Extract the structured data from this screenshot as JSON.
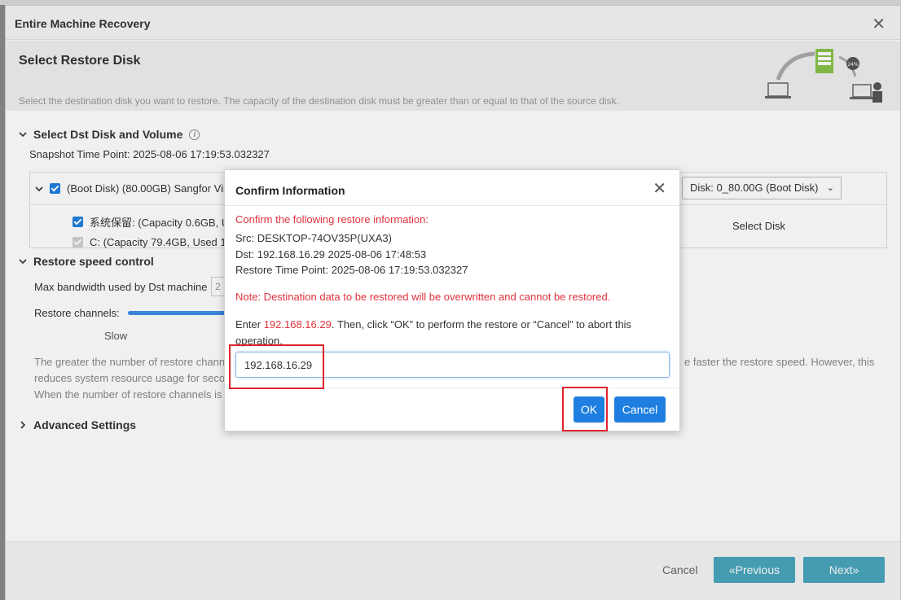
{
  "window": {
    "title": "Entire Machine Recovery",
    "step_title": "Select Restore Disk",
    "step_description": "Select the destination disk you want to restore. The capacity of the destination disk must be greater than or equal to that of the source disk.",
    "illustration_progress": "24%"
  },
  "disk_section": {
    "header": "Select Dst Disk and Volume",
    "snapshot": "Snapshot Time Point: 2025-08-06 17:19:53.032327",
    "boot_disk_label": "(Boot Disk) (80.00GB) Sangfor Vir",
    "volume1_label": "系统保留: (Capacity 0.6GB, U",
    "volume2_label": "C: (Capacity 79.4GB, Used 1!",
    "disk_select_value": "Disk: 0_80.00G (Boot Disk)",
    "select_disk_link": "Select Disk"
  },
  "speed_section": {
    "header": "Restore speed control",
    "bandwidth_label": "Max bandwidth used by Dst machine",
    "bandwidth_box": "2",
    "channels_label": "Restore channels:",
    "slow_label": "Slow",
    "note_line1_left": "The greater the number of restore chann",
    "note_line2_left": "reduces system resource usage for seco",
    "note_line3_left": "When the number of restore channels is",
    "note_line1_right": "e faster the restore speed. However, this"
  },
  "advanced": {
    "header": "Advanced Settings"
  },
  "footer": {
    "cancel": "Cancel",
    "previous": "«Previous",
    "next": "Next»"
  },
  "dialog": {
    "title": "Confirm Information",
    "confirm_heading": "Confirm the following restore information:",
    "src": "Src: DESKTOP-74OV35P(UXA3)",
    "dst": "Dst: 192.168.16.29 2025-08-06 17:48:53",
    "time_point": "Restore Time Point: 2025-08-06 17:19:53.032327",
    "warning": "Note: Destination data to be restored will be overwritten and cannot be restored.",
    "enter_prefix": "Enter ",
    "enter_ip": "192.168.16.29",
    "enter_suffix": ". Then, click “OK” to perform the restore or “Cancel” to abort this",
    "enter_line2": "operation.",
    "input_value": "192.168.16.29",
    "ok": "OK",
    "cancel": "Cancel"
  },
  "colors": {
    "primary_blue": "#1e7fe0",
    "teal": "#4aa6bd",
    "red": "#e0323c",
    "highlight_red": "#e0232d"
  }
}
